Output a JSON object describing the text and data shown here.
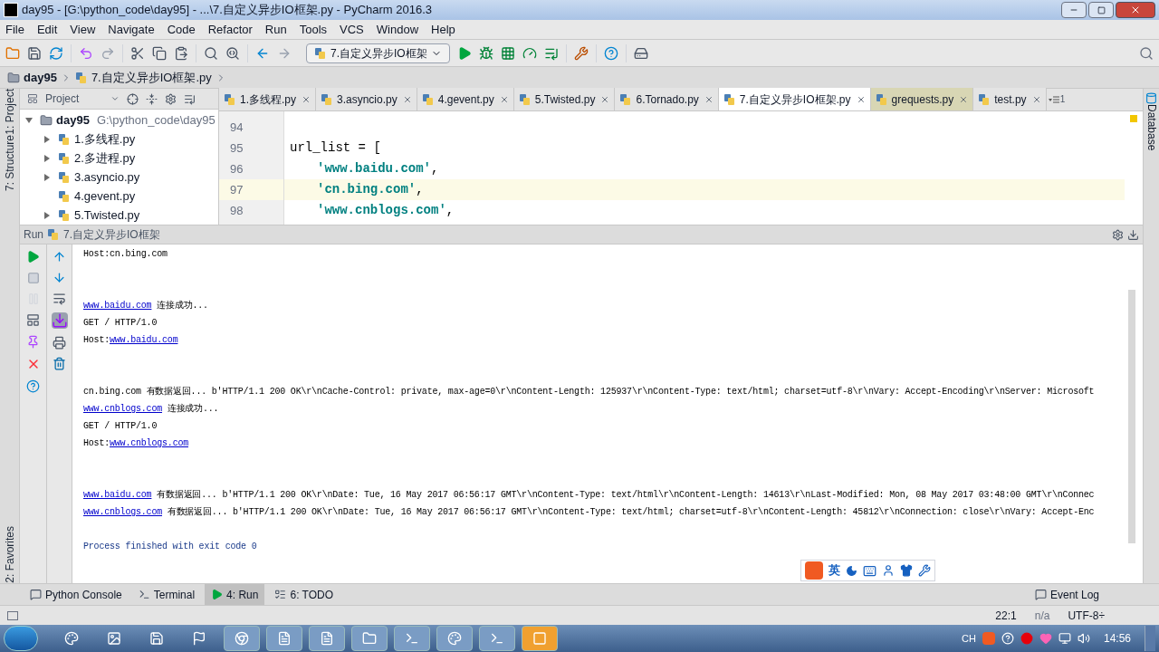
{
  "window": {
    "title": "day95 - [G:\\python_code\\day95] - ...\\7.自定义异步IO框架.py - PyCharm 2016.3"
  },
  "menu": [
    "File",
    "Edit",
    "View",
    "Navigate",
    "Code",
    "Refactor",
    "Run",
    "Tools",
    "VCS",
    "Window",
    "Help"
  ],
  "toolbar": {
    "run_config": "7.自定义异步IO框架"
  },
  "breadcrumb": [
    "day95",
    "7.自定义异步IO框架.py"
  ],
  "left_strip": [
    "1: Project",
    "7: Structure",
    "2: Favorites"
  ],
  "right_strip": [
    "Database"
  ],
  "project_panel": {
    "title": "Project",
    "root": {
      "name": "day95",
      "path": "G:\\python_code\\day95",
      "expanded": true,
      "children": [
        {
          "name": "1.多线程.py",
          "collapsible": true
        },
        {
          "name": "2.多进程.py",
          "collapsible": true
        },
        {
          "name": "3.asyncio.py",
          "collapsible": true
        },
        {
          "name": "4.gevent.py",
          "collapsible": false
        },
        {
          "name": "5.Twisted.py",
          "collapsible": true
        }
      ]
    }
  },
  "editor_tabs": [
    {
      "label": "1.多线程.py",
      "selected": false,
      "kind": "project"
    },
    {
      "label": "3.asyncio.py",
      "selected": false,
      "kind": "project"
    },
    {
      "label": "4.gevent.py",
      "selected": false,
      "kind": "project"
    },
    {
      "label": "5.Twisted.py",
      "selected": false,
      "kind": "project"
    },
    {
      "label": "6.Tornado.py",
      "selected": false,
      "kind": "project"
    },
    {
      "label": "7.自定义异步IO框架.py",
      "selected": true,
      "kind": "project"
    },
    {
      "label": "grequests.py",
      "selected": false,
      "kind": "library"
    },
    {
      "label": "test.py",
      "selected": false,
      "kind": "project"
    }
  ],
  "tab_overflow": "1",
  "editor_lines": [
    {
      "number": "94",
      "current": false
    },
    {
      "number": "95",
      "current": false,
      "segments": [
        {
          "kind": "plain",
          "text": "url_list = ["
        }
      ]
    },
    {
      "number": "96",
      "current": false,
      "segments": [
        {
          "kind": "string",
          "text": "'www.baidu.com'"
        },
        {
          "kind": "plain",
          "text": ","
        }
      ]
    },
    {
      "number": "97",
      "current": true,
      "segments": [
        {
          "kind": "string",
          "text": "'cn.bing.com'"
        },
        {
          "kind": "plain",
          "text": ","
        }
      ]
    },
    {
      "number": "98",
      "current": false,
      "segments": [
        {
          "kind": "string",
          "text": "'www.cnblogs.com'"
        },
        {
          "kind": "plain",
          "text": ","
        }
      ]
    }
  ],
  "run_panel": {
    "label": "Run",
    "config": "7.自定义异步IO框架"
  },
  "output_blocks": [
    {
      "kind": "normal",
      "lines": [
        [
          {
            "kind": "text",
            "text": "Host:cn.bing.com"
          }
        ]
      ]
    },
    {
      "kind": "normal",
      "lines": [
        [
          {
            "kind": "link",
            "text": "www.baidu.com"
          },
          {
            "kind": "text",
            "text": " 连接成功..."
          }
        ],
        [
          {
            "kind": "text",
            "text": "GET / HTTP/1.0"
          }
        ],
        [
          {
            "kind": "text",
            "text": "Host:"
          },
          {
            "kind": "link",
            "text": "www.baidu.com"
          }
        ]
      ]
    },
    {
      "kind": "normal",
      "lines": [
        [
          {
            "kind": "text",
            "text": "cn.bing.com 有数据返回... b'HTTP/1.1 200 OK\\r\\nCache-Control: private, max-age=0\\r\\nContent-Length: 125937\\r\\nContent-Type: text/html; charset=utf-8\\r\\nVary: Accept-Encoding\\r\\nServer: Microsoft"
          }
        ],
        [
          {
            "kind": "link",
            "text": "www.cnblogs.com"
          },
          {
            "kind": "text",
            "text": " 连接成功..."
          }
        ],
        [
          {
            "kind": "text",
            "text": "GET / HTTP/1.0"
          }
        ],
        [
          {
            "kind": "text",
            "text": "Host:"
          },
          {
            "kind": "link",
            "text": "www.cnblogs.com"
          }
        ]
      ]
    },
    {
      "kind": "normal",
      "lines": [
        [
          {
            "kind": "link",
            "text": "www.baidu.com"
          },
          {
            "kind": "text",
            "text": " 有数据返回... b'HTTP/1.1 200 OK\\r\\nDate: Tue, 16 May 2017 06:56:17 GMT\\r\\nContent-Type: text/html\\r\\nContent-Length: 14613\\r\\nLast-Modified: Mon, 08 May 2017 03:48:00 GMT\\r\\nConnec"
          }
        ],
        [
          {
            "kind": "link",
            "text": "www.cnblogs.com"
          },
          {
            "kind": "text",
            "text": " 有数据返回... b'HTTP/1.1 200 OK\\r\\nDate: Tue, 16 May 2017 06:56:17 GMT\\r\\nContent-Type: text/html; charset=utf-8\\r\\nContent-Length: 45812\\r\\nConnection: close\\r\\nVary: Accept-Enc"
          }
        ]
      ]
    },
    {
      "kind": "exit",
      "lines": [
        [
          {
            "kind": "text",
            "text": "Process finished with exit code 0"
          }
        ]
      ]
    }
  ],
  "ime_bar": {
    "mode": "英"
  },
  "bottom_tabs": [
    {
      "label": "Python Console",
      "selected": false
    },
    {
      "label": "Terminal",
      "selected": false
    },
    {
      "label": "4: Run",
      "selected": true
    },
    {
      "label": "6: TODO",
      "selected": false
    }
  ],
  "event_log": "Event Log",
  "status_bar": {
    "position": "22:1",
    "separator": "n/a",
    "encoding": "UTF-8÷"
  },
  "taskbar": {
    "language": "CH",
    "clock": "14:56"
  }
}
